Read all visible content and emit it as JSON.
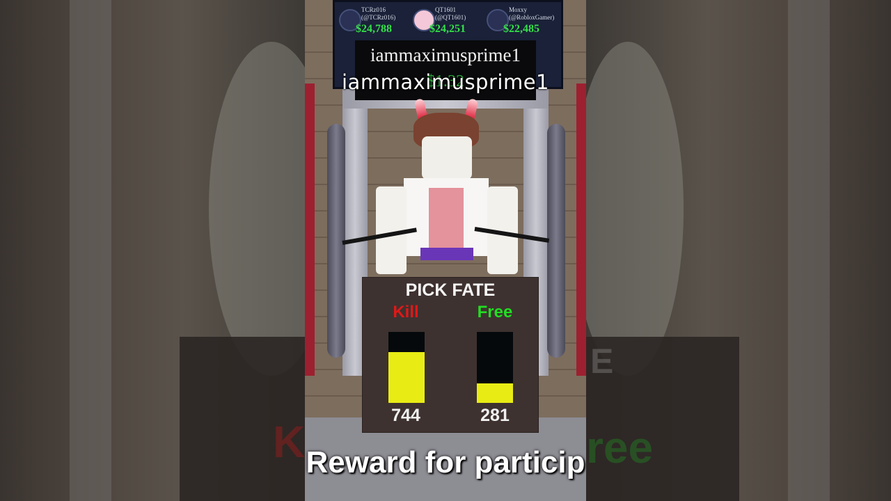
{
  "leaderboard": {
    "entries": [
      {
        "name": "TCRz016",
        "handle": "(@TCRz016)",
        "amount": "$24,788"
      },
      {
        "name": "QT1601",
        "handle": "(@QT1601)",
        "amount": "$24,251"
      },
      {
        "name": "Moxxy",
        "handle": "(@RobloxGamer)",
        "amount": "$22,485"
      }
    ]
  },
  "player": {
    "name_tag": "iammaximusprime1",
    "name_tag_sub": "$1.32",
    "name_overlay": "iammaximusprime1"
  },
  "fate_panel": {
    "title": "PICK FATE",
    "options": [
      {
        "label": "Kill",
        "count": "744",
        "fill_fraction": 0.72,
        "color": "#e01818"
      },
      {
        "label": "Free",
        "count": "281",
        "fill_fraction": 0.27,
        "color": "#22dd22"
      }
    ],
    "bar_color": "#e8ec14"
  },
  "caption": {
    "text": "Reward for particip"
  },
  "background_ghost": {
    "left_word": "Ki",
    "right_word": "ree",
    "right_panel_letter": "E"
  }
}
